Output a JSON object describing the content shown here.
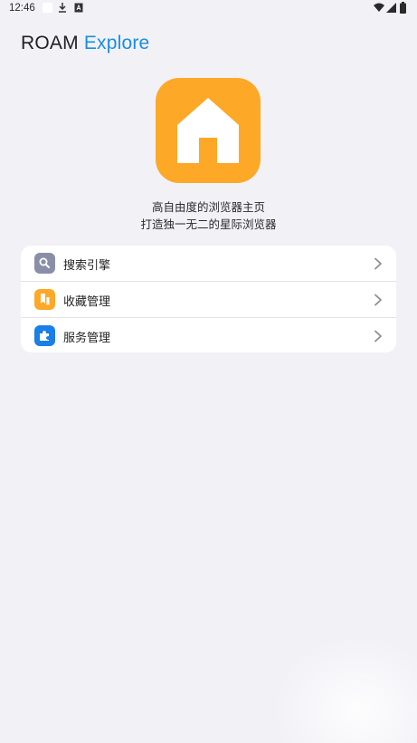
{
  "status_bar": {
    "time": "12:46",
    "icons": [
      "blank-notification-icon",
      "download-icon",
      "app-notification-icon",
      "wifi-icon",
      "cellular-signal-icon",
      "battery-icon"
    ]
  },
  "header": {
    "title_part1": "ROAM",
    "title_part2": "Explore"
  },
  "hero": {
    "icon": "home-icon",
    "line1": "高自由度的浏览器主页",
    "line2": "打造独一无二的星际浏览器"
  },
  "menu": {
    "items": [
      {
        "label": "搜索引擎",
        "icon": "search-icon",
        "icon_color": "#8a8fa8"
      },
      {
        "label": "收藏管理",
        "icon": "bookmark-icon",
        "icon_color": "#fda827"
      },
      {
        "label": "服务管理",
        "icon": "puzzle-icon",
        "icon_color": "#1a7fe6"
      }
    ]
  },
  "colors": {
    "background": "#f2f1f6",
    "accent": "#1a8ee0",
    "hero_icon": "#fda827"
  }
}
